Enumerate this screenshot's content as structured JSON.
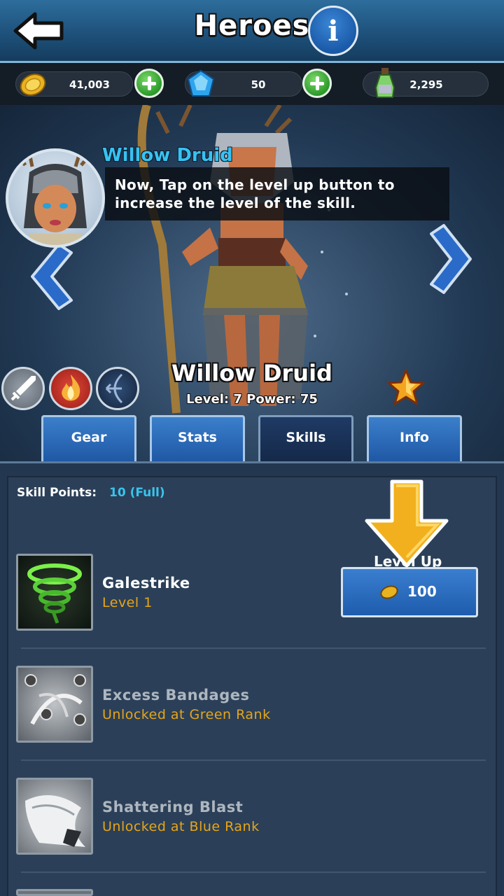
{
  "header": {
    "title": "Heroes",
    "back_icon": "back-arrow-icon",
    "info_label": "i"
  },
  "currencies": [
    {
      "name": "gold",
      "icon": "coin-icon",
      "value": "41,003"
    },
    {
      "name": "gems",
      "icon": "gem-icon",
      "value": "50"
    },
    {
      "name": "potion",
      "icon": "potion-icon",
      "value": "2,295"
    }
  ],
  "tutorial": {
    "speaker": "Willow Druid",
    "text": "Now, Tap on the level up button to increase the level of the skill."
  },
  "hero": {
    "name": "Willow Druid",
    "stats": "Level: 7  Power: 75",
    "class_icons": [
      "sword-icon",
      "fire-icon",
      "bow-icon"
    ],
    "star_icon": "star-icon"
  },
  "tabs": [
    {
      "label": "Gear",
      "active": false
    },
    {
      "label": "Stats",
      "active": false
    },
    {
      "label": "Skills",
      "active": true
    },
    {
      "label": "Info",
      "active": false
    }
  ],
  "skills_panel": {
    "points_label": "Skill Points:",
    "points_value": "10 (Full)",
    "level_up_label": "Level Up",
    "level_up_cost": "100",
    "skills": [
      {
        "name": "Galestrike",
        "status": "Level 1",
        "icon": "tornado-icon"
      },
      {
        "name": "Excess Bandages",
        "status": "Unlocked at Green Rank",
        "icon": "bandage-icon"
      },
      {
        "name": "Shattering Blast",
        "status": "Unlocked at Blue Rank",
        "icon": "blast-icon"
      }
    ]
  },
  "colors": {
    "accent_blue": "#37c2f2",
    "status_orange": "#e7a51a",
    "tab_blue": "#2a6bb9",
    "plus_green": "#2c9a2a"
  }
}
